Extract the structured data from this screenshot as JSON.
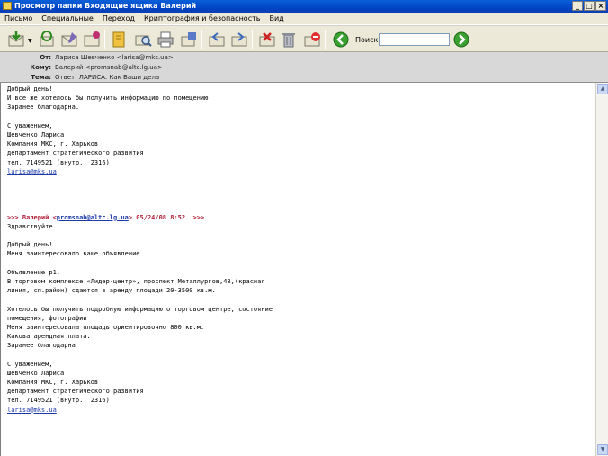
{
  "window": {
    "title": "Просмотр папки Входящие ящика Валерий",
    "controls": [
      "_",
      "□",
      "×"
    ]
  },
  "menu": [
    "Письмо",
    "Специальные",
    "Переход",
    "Криптография и безопасность",
    "Вид"
  ],
  "toolbar": {
    "search_label": "Поиск:",
    "search_value": ""
  },
  "headers": {
    "from_label": "От:",
    "from_value": "Лариса Шевченко <larisa@mks.ua>",
    "to_label": "Кому:",
    "to_value": "Валерий <promsnab@altc.lg.ua>",
    "subject_label": "Тема:",
    "subject_value": "Ответ: ЛАРИСА. Как Ваши дела"
  },
  "message": {
    "reply_lines": [
      "Добрый день!",
      "И все же хотелось бы получить информацию по помещению.",
      "Заранее благодарна.",
      "",
      "С уважением,",
      "Шевченко Лариса",
      "Компания МКС, г. Харьков",
      "департамент стратегического развития",
      "тел. 7149521 (внутр.  2316)"
    ],
    "reply_email": "larisa@mks.ua",
    "quote_prefix": ">>> Валерий <",
    "quote_email": "promsnab@altc.lg.ua",
    "quote_suffix": "> 05/24/08 8:52  >>>",
    "quoted_lines": [
      "Здравствуйте.",
      "",
      "Добрый день!",
      "Меня заинтересовало ваше объявление",
      "",
      "Объявление р1.",
      "В торговом комплексе «Лидер-центр», проспект Металлургов,48,(красная",
      "линия, сп.район) сдаются в аренду площади 20-3500 кв.м.",
      "",
      "Хотелось бы получить подробную информацию о торговом центре, состояние",
      "помещения, фотографии",
      "Меня заинтересовала площадь ориентировочно 800 кв.м.",
      "Какова арендная плата.",
      "Заранее благодарна",
      "",
      "С уважением,",
      "Шевченко Лариса",
      "Компания МКС, г. Харьков",
      "департамент стратегического развития",
      "тел. 7149521 (внутр.  2316)"
    ],
    "quoted_email": "larisa@mks.ua"
  }
}
